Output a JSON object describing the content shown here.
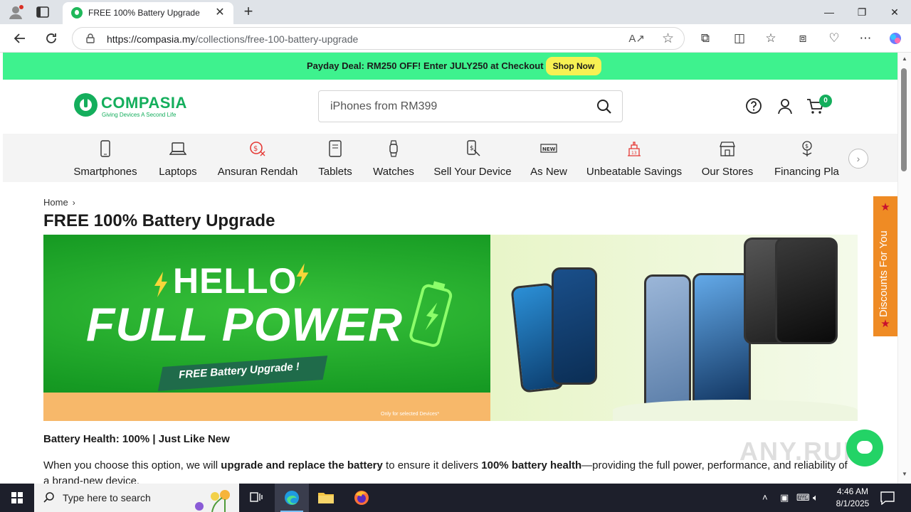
{
  "browser": {
    "tab_title": "FREE 100% Battery Upgrade",
    "new_tab_symbol": "+",
    "url_host": "https://compasia.my",
    "url_path": "/collections/free-100-battery-upgrade",
    "window_controls": [
      "minimize",
      "restore",
      "close"
    ]
  },
  "promo": {
    "text": "Payday Deal: RM250 OFF! Enter JULY250 at Checkout",
    "button": "Shop Now",
    "bg_color": "#3ef28e"
  },
  "header": {
    "logo_name": "COMPASIA",
    "logo_tagline": "Giving Devices A Second Life",
    "search_placeholder": "iPhones from RM399",
    "cart_count": "0",
    "brand_color": "#14ae5c"
  },
  "categories": [
    {
      "label": "Smartphones",
      "icon": "smartphone-icon"
    },
    {
      "label": "Laptops",
      "icon": "laptop-icon"
    },
    {
      "label": "Ansuran Rendah",
      "icon": "installment-icon"
    },
    {
      "label": "Tablets",
      "icon": "tablet-icon"
    },
    {
      "label": "Watches",
      "icon": "watch-icon"
    },
    {
      "label": "Sell Your Device",
      "icon": "sell-device-icon"
    },
    {
      "label": "As New",
      "icon": "new-badge-icon"
    },
    {
      "label": "Unbeatable Savings",
      "icon": "savings-icon"
    },
    {
      "label": "Our Stores",
      "icon": "store-icon"
    },
    {
      "label": "Financing Pla",
      "icon": "financing-icon"
    }
  ],
  "main": {
    "breadcrumb_home": "Home",
    "title": "FREE 100% Battery Upgrade",
    "banner": {
      "hello": "HELLO",
      "full_power": "FULL POWER",
      "ribbon": "FREE Battery Upgrade !",
      "disclaimer": "Only for selected Devices*"
    },
    "health_line": "Battery Health: 100% | Just Like New",
    "desc_1": "When you choose this option, we will ",
    "desc_bold_1": "upgrade and replace the battery",
    "desc_2": " to ensure it delivers ",
    "desc_bold_2": "100% battery health",
    "desc_3": "—providing the full power, performance, and reliability of a brand-new device."
  },
  "side_tab": {
    "label": "Discounts For You"
  },
  "watermark": "ANY.RUN",
  "taskbar": {
    "search_placeholder": "Type here to search",
    "time": "4:46 AM",
    "date": "8/1/2025"
  }
}
